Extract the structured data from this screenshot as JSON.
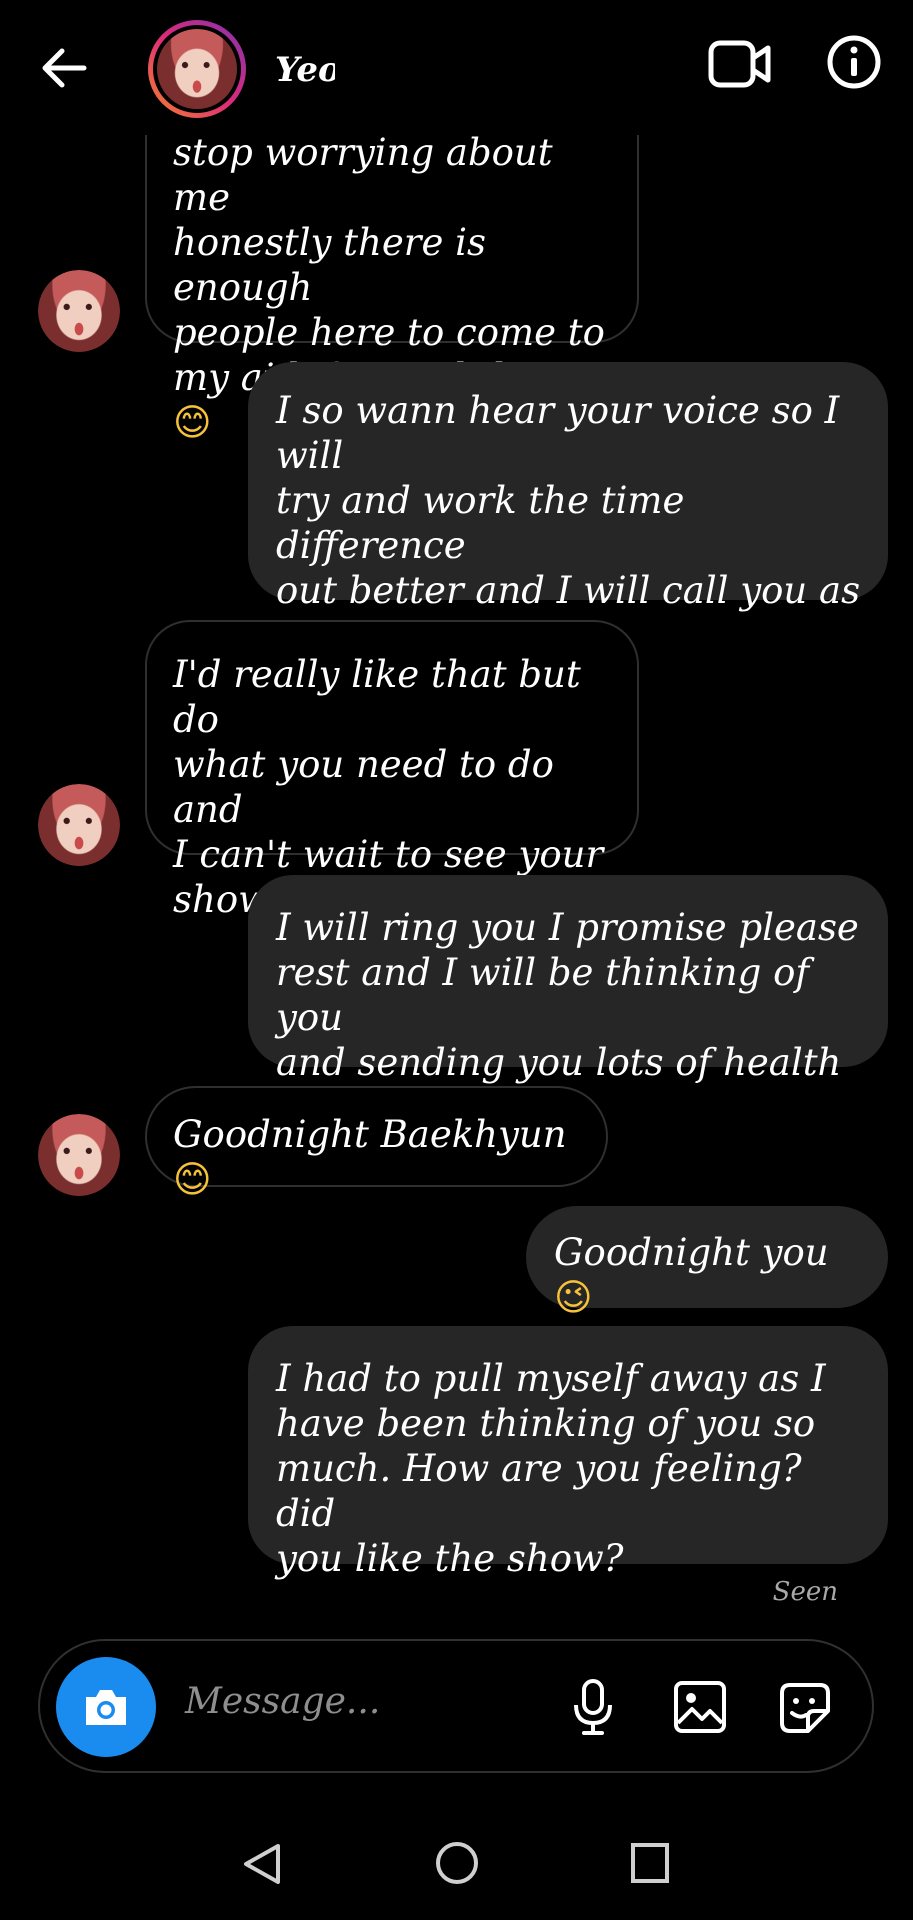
{
  "header": {
    "title": "Yeol"
  },
  "messages": [
    {
      "from": "them",
      "text": "stop worrying about me\nhonestly there is enough\npeople here to come to\nmy aid if I need them",
      "emoji": "😊"
    },
    {
      "from": "me",
      "text": "I so wann hear your voice so I will\ntry and work the time difference\nout better and I will call you as\nsoon as I can",
      "emoji": ""
    },
    {
      "from": "them",
      "text": "I'd really like that but do\nwhat you need to do and\nI can't wait to see your\nshow tomorrow here",
      "emoji": "♥"
    },
    {
      "from": "me",
      "text": "I will ring you I promise please\nrest and I will be thinking of you\nand sending you lots of health",
      "emoji": ""
    },
    {
      "from": "them",
      "text": "Goodnight Baekhyun",
      "emoji": "😊"
    },
    {
      "from": "me",
      "text": "Goodnight you",
      "emoji": "😉"
    },
    {
      "from": "me",
      "text": "I had to pull myself away as I\nhave been thinking of you so\nmuch. How are you feeling? did\nyou like the show?",
      "emoji": ""
    }
  ],
  "status": {
    "seen": "Seen"
  },
  "composer": {
    "placeholder": "Message..."
  },
  "colors": {
    "background": "#000000",
    "sent_bubble": "#262626",
    "camera_button": "#1a8cf0",
    "heart": "#e0202a"
  },
  "icons": [
    "back-arrow-icon",
    "video-call-icon",
    "info-icon",
    "camera-icon",
    "microphone-icon",
    "gallery-icon",
    "sticker-icon",
    "nav-back-icon",
    "nav-home-icon",
    "nav-recents-icon"
  ]
}
